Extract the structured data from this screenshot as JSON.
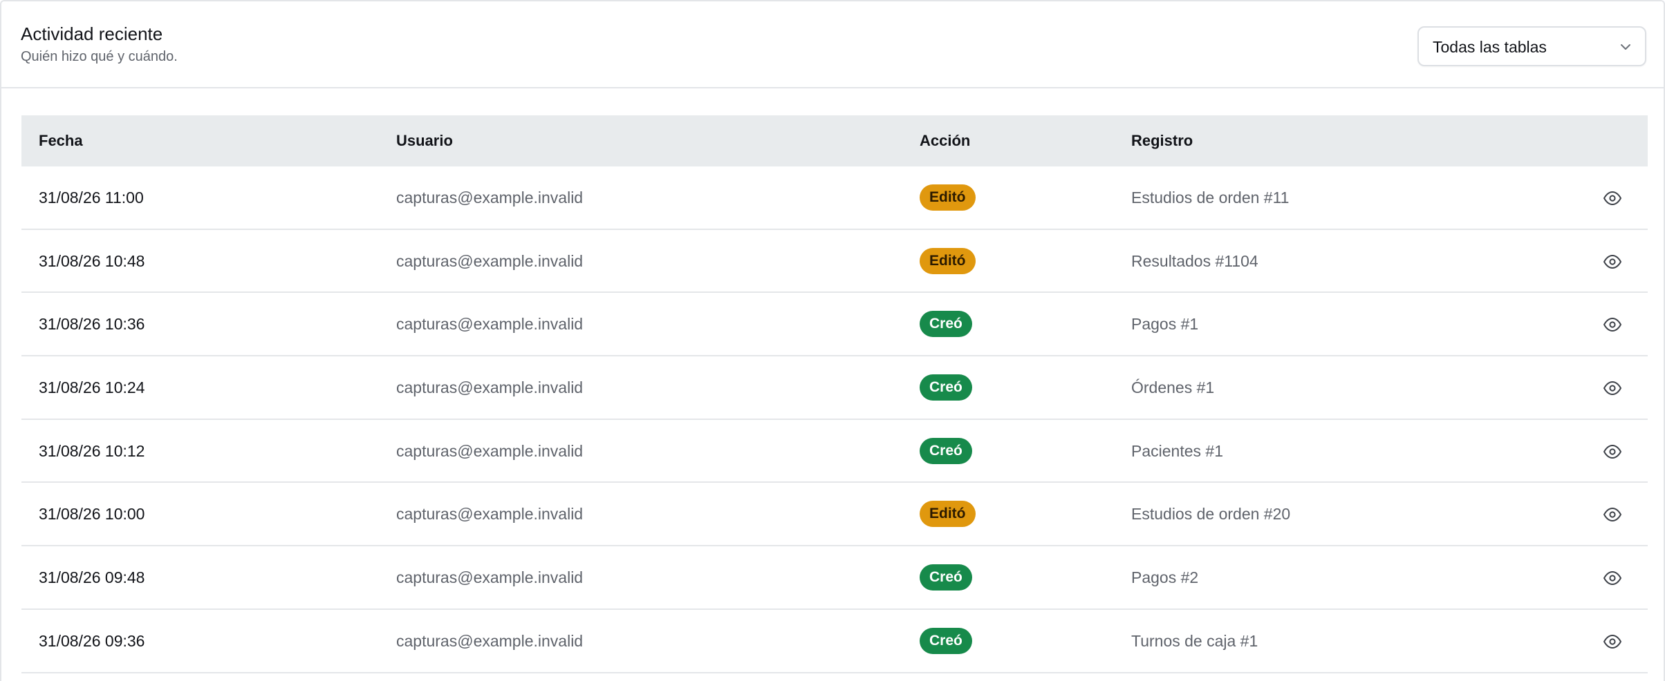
{
  "header": {
    "title": "Actividad reciente",
    "subtitle": "Quién hizo qué y cuándo."
  },
  "filter": {
    "selected": "Todas las tablas"
  },
  "table": {
    "columns": [
      "Fecha",
      "Usuario",
      "Acción",
      "Registro"
    ],
    "rows": [
      {
        "date": "31/08/26 11:00",
        "user": "capturas@example.invalid",
        "action": "Editó",
        "action_type": "edit",
        "record": "Estudios de orden #11"
      },
      {
        "date": "31/08/26 10:48",
        "user": "capturas@example.invalid",
        "action": "Editó",
        "action_type": "edit",
        "record": "Resultados #1104"
      },
      {
        "date": "31/08/26 10:36",
        "user": "capturas@example.invalid",
        "action": "Creó",
        "action_type": "create",
        "record": "Pagos #1"
      },
      {
        "date": "31/08/26 10:24",
        "user": "capturas@example.invalid",
        "action": "Creó",
        "action_type": "create",
        "record": "Órdenes #1"
      },
      {
        "date": "31/08/26 10:12",
        "user": "capturas@example.invalid",
        "action": "Creó",
        "action_type": "create",
        "record": "Pacientes #1"
      },
      {
        "date": "31/08/26 10:00",
        "user": "capturas@example.invalid",
        "action": "Editó",
        "action_type": "edit",
        "record": "Estudios de orden #20"
      },
      {
        "date": "31/08/26 09:48",
        "user": "capturas@example.invalid",
        "action": "Creó",
        "action_type": "create",
        "record": "Pagos #2"
      },
      {
        "date": "31/08/26 09:36",
        "user": "capturas@example.invalid",
        "action": "Creó",
        "action_type": "create",
        "record": "Turnos de caja #1"
      }
    ],
    "row_icon": "eye-icon"
  },
  "colors": {
    "edit_badge": "#e0980e",
    "create_badge": "#178a4b",
    "header_bg": "#e8ebed",
    "muted_text": "#5f636b"
  }
}
